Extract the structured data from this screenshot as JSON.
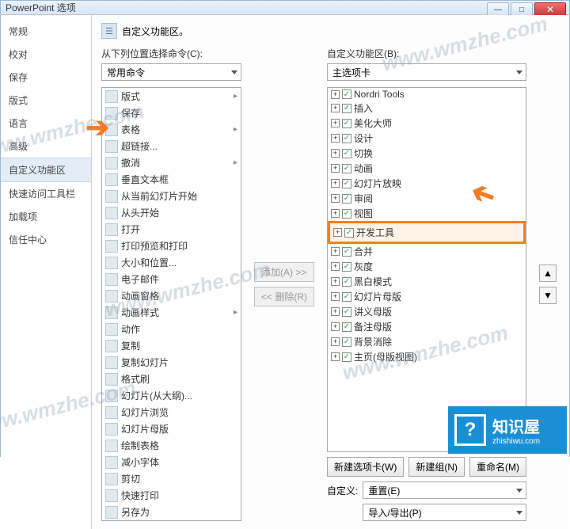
{
  "window": {
    "title": "PowerPoint 选项"
  },
  "sidebar": {
    "items": [
      {
        "label": "常规"
      },
      {
        "label": "校对"
      },
      {
        "label": "保存"
      },
      {
        "label": "版式"
      },
      {
        "label": "语言"
      },
      {
        "label": "高级"
      },
      {
        "label": "自定义功能区"
      },
      {
        "label": "快速访问工具栏"
      },
      {
        "label": "加载项"
      },
      {
        "label": "信任中心"
      }
    ],
    "activeIndex": 6
  },
  "heading": "自定义功能区。",
  "leftCol": {
    "label": "从下列位置选择命令(C):",
    "dropdown": "常用命令",
    "commands": [
      {
        "label": "版式",
        "sub": true
      },
      {
        "label": "保存"
      },
      {
        "label": "表格",
        "sub": true
      },
      {
        "label": "超链接..."
      },
      {
        "label": "撤消",
        "sub": true
      },
      {
        "label": "垂直文本框"
      },
      {
        "label": "从当前幻灯片开始"
      },
      {
        "label": "从头开始"
      },
      {
        "label": "打开"
      },
      {
        "label": "打印预览和打印"
      },
      {
        "label": "大小和位置..."
      },
      {
        "label": "电子邮件"
      },
      {
        "label": "动画窗格"
      },
      {
        "label": "动画样式",
        "sub": true
      },
      {
        "label": "动作"
      },
      {
        "label": "复制"
      },
      {
        "label": "复制幻灯片"
      },
      {
        "label": "格式刷"
      },
      {
        "label": "幻灯片(从大纲)..."
      },
      {
        "label": "幻灯片浏览"
      },
      {
        "label": "幻灯片母版"
      },
      {
        "label": "绘制表格"
      },
      {
        "label": "减小字体"
      },
      {
        "label": "剪切"
      },
      {
        "label": "快速打印"
      },
      {
        "label": "另存为"
      }
    ]
  },
  "midButtons": {
    "add": "添加(A) >>",
    "remove": "<< 删除(R)"
  },
  "rightCol": {
    "label": "自定义功能区(B):",
    "dropdown": "主选项卡",
    "tree": [
      {
        "label": "Nordri Tools",
        "checked": true
      },
      {
        "label": "插入",
        "checked": true
      },
      {
        "label": "美化大师",
        "checked": true
      },
      {
        "label": "设计",
        "checked": true
      },
      {
        "label": "切换",
        "checked": true
      },
      {
        "label": "动画",
        "checked": true
      },
      {
        "label": "幻灯片放映",
        "checked": true
      },
      {
        "label": "审阅",
        "checked": true
      },
      {
        "label": "视图",
        "checked": true
      },
      {
        "label": "开发工具",
        "checked": true,
        "highlight": true
      },
      {
        "label": "合并",
        "checked": true
      },
      {
        "label": "灰度",
        "checked": true
      },
      {
        "label": "黑白模式",
        "checked": true
      },
      {
        "label": "幻灯片母版",
        "checked": true
      },
      {
        "label": "讲义母版",
        "checked": true
      },
      {
        "label": "备注母版",
        "checked": true
      },
      {
        "label": "背景消除",
        "checked": true
      },
      {
        "label": "主页(母版视图)",
        "checked": true
      }
    ]
  },
  "updown": {
    "up": "▲",
    "down": "▼"
  },
  "bottomButtons": {
    "newTab": "新建选项卡(W)",
    "newGroup": "新建组(N)",
    "rename": "重命名(M)"
  },
  "customRow": {
    "label": "自定义:",
    "reset": "重置(E)",
    "importExport": "导入/导出(P)"
  },
  "watermark": "www.wmzhe.com",
  "logo": {
    "icon": "?",
    "title": "知识屋",
    "sub": "zhishiwu.com"
  }
}
